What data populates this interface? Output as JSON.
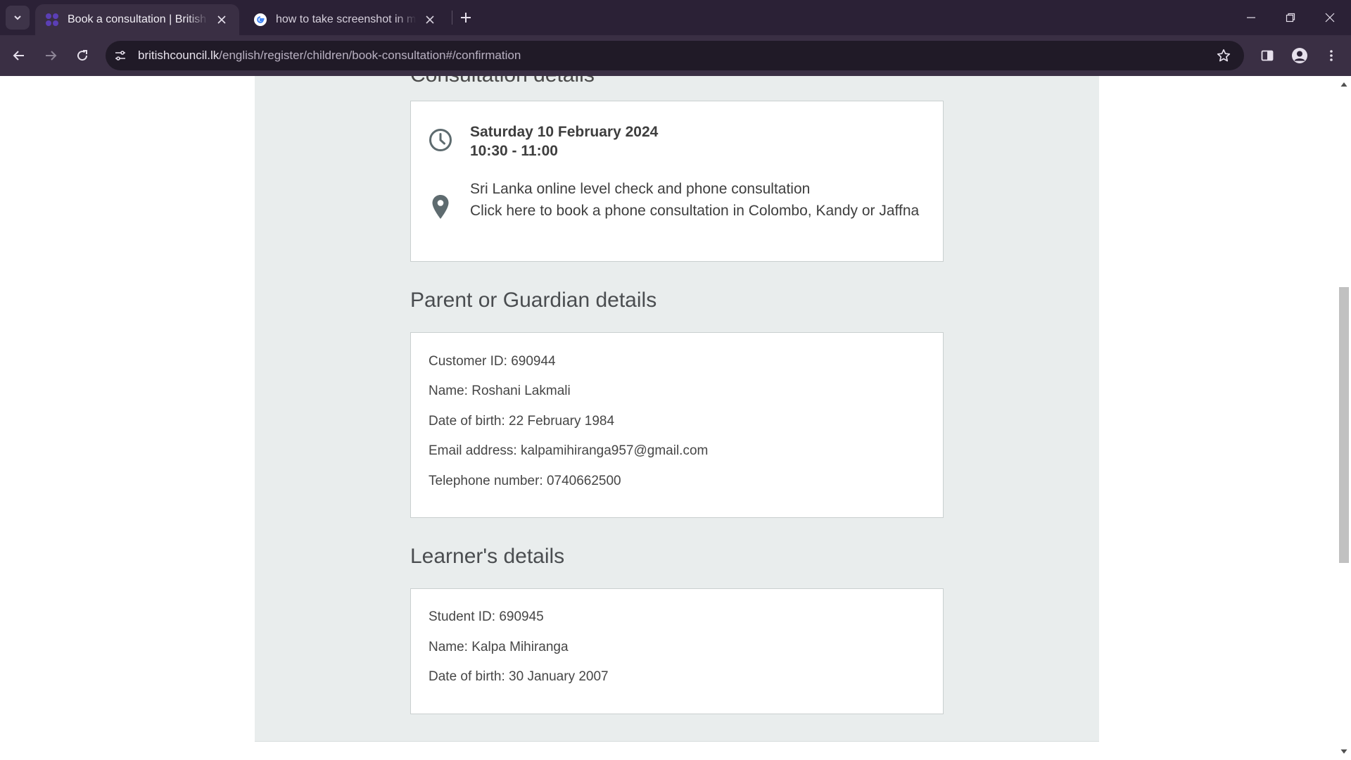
{
  "browser": {
    "tabs": [
      {
        "title": "Book a consultation | British Council",
        "active": true
      },
      {
        "title": "how to take screenshot in msi laptop",
        "active": false
      }
    ],
    "url_host": "britishcouncil.lk",
    "url_path": "/english/register/children/book-consultation#/confirmation"
  },
  "consultation": {
    "heading": "Consultation details",
    "date": "Saturday 10 February 2024",
    "time": "10:30 - 11:00",
    "venue_title": "Sri Lanka online level check and phone consultation",
    "venue_link": "Click here to book a phone consultation in Colombo, Kandy or Jaffna"
  },
  "parent": {
    "heading": "Parent or Guardian details",
    "customer_id": "Customer ID: 690944",
    "name": "Name: Roshani Lakmali",
    "dob": "Date of birth: 22 February 1984",
    "email": "Email address: kalpamihiranga957@gmail.com",
    "phone": "Telephone number: 0740662500"
  },
  "learner": {
    "heading": "Learner's details",
    "student_id": "Student ID: 690945",
    "name": "Name: Kalpa Mihiranga",
    "dob": "Date of birth: 30 January 2007"
  },
  "icons": [
    "tab-search-icon",
    "british-council-favicon",
    "google-favicon",
    "close-icon",
    "plus-icon",
    "minimize-icon",
    "restore-icon",
    "window-close-icon",
    "back-icon",
    "forward-icon",
    "reload-icon",
    "site-info-icon",
    "star-icon",
    "side-panel-icon",
    "profile-icon",
    "menu-icon",
    "clock-icon",
    "location-pin-icon"
  ],
  "colors": {
    "tabbar": "#2b2136",
    "toolbar": "#3a2f44",
    "content_background": "#e9eded",
    "card_border": "#c9cfcf",
    "icon_grey": "#5e6b6f"
  }
}
